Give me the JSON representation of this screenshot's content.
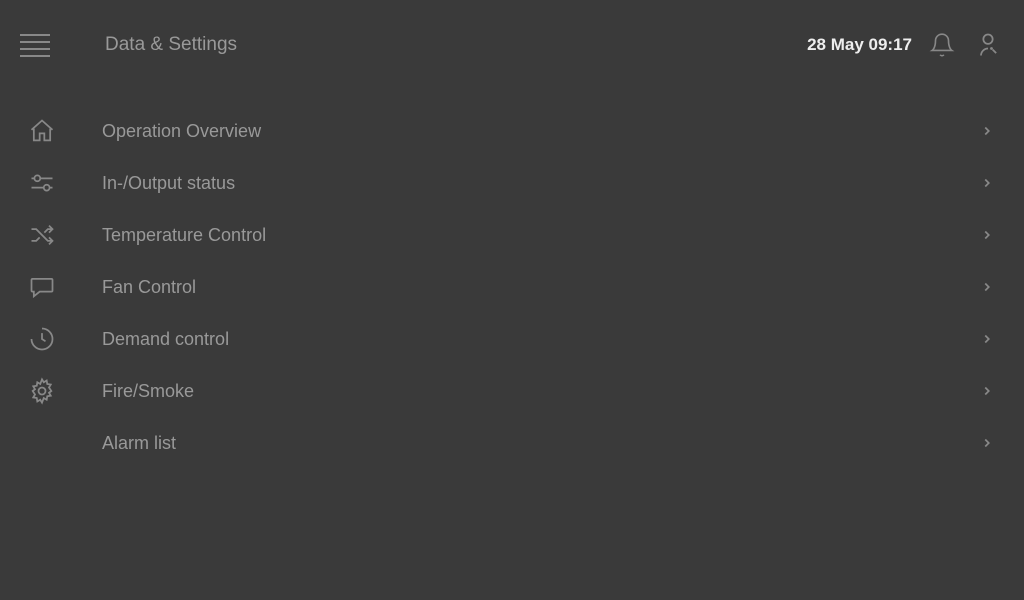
{
  "header": {
    "title": "Data & Settings",
    "datetime": "28 May 09:17"
  },
  "menu": {
    "items": [
      {
        "label": "Operation Overview",
        "icon": "home"
      },
      {
        "label": "In-/Output status",
        "icon": "sliders"
      },
      {
        "label": "Temperature Control",
        "icon": "shuffle"
      },
      {
        "label": "Fan Control",
        "icon": "speech"
      },
      {
        "label": "Demand control",
        "icon": "clock"
      },
      {
        "label": "Fire/Smoke",
        "icon": "gear"
      },
      {
        "label": "Alarm list",
        "icon": "none"
      }
    ]
  }
}
